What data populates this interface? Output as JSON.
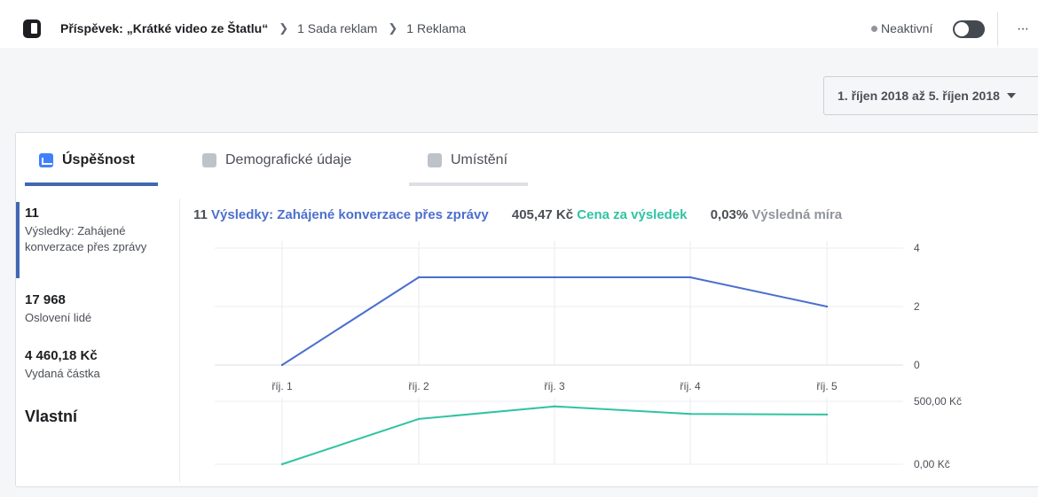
{
  "header": {
    "title": "Příspěvek: „Krátké video ze Štatlu“",
    "breadcrumbs": [
      "1 Sada reklam",
      "1 Reklama"
    ],
    "status": "Neaktivní",
    "more": "···"
  },
  "date_range": "1. říjen 2018 až 5. říjen 2018",
  "tabs": [
    {
      "label": "Úspěšnost",
      "active": true
    },
    {
      "label": "Demografické údaje",
      "active": false
    },
    {
      "label": "Umístění",
      "active": false
    }
  ],
  "metrics": [
    {
      "value": "11",
      "label": "Výsledky: Zahájené konverzace přes zprávy",
      "selected": true
    },
    {
      "value": "17 968",
      "label": "Oslovení lidé",
      "selected": false
    },
    {
      "value": "4 460,18 Kč",
      "label": "Vydaná částka",
      "selected": false
    }
  ],
  "custom_label": "Vlastní",
  "summary": {
    "results_value": "11",
    "results_label": "Výsledky: Zahájené konverzace přes zprávy",
    "cost_value": "405,47 Kč",
    "cost_label": "Cena za výsledek",
    "rate_value": "0,03%",
    "rate_label": "Výsledná míra"
  },
  "colors": {
    "results": "#4c6fcf",
    "cost": "#30c3a3",
    "rate": "#90949c",
    "accent": "#4267b2"
  },
  "chart_data": [
    {
      "type": "line",
      "categories": [
        "říj. 1",
        "říj. 2",
        "říj. 3",
        "říj. 4",
        "říj. 5"
      ],
      "series": [
        {
          "values": [
            0,
            3,
            3,
            3,
            2
          ],
          "color": "#4c6fcf"
        }
      ],
      "yticks": [
        "0",
        "2",
        "4"
      ],
      "ylim": [
        0,
        4
      ],
      "grid": true
    },
    {
      "type": "line",
      "categories": [
        "říj. 1",
        "říj. 2",
        "říj. 3",
        "říj. 4",
        "říj. 5"
      ],
      "series": [
        {
          "values": [
            0,
            360,
            460,
            400,
            395
          ],
          "color": "#30c3a3"
        }
      ],
      "yticks": [
        "0,00 Kč",
        "500,00 Kč"
      ],
      "ylim": [
        0,
        500
      ],
      "grid": true
    }
  ]
}
